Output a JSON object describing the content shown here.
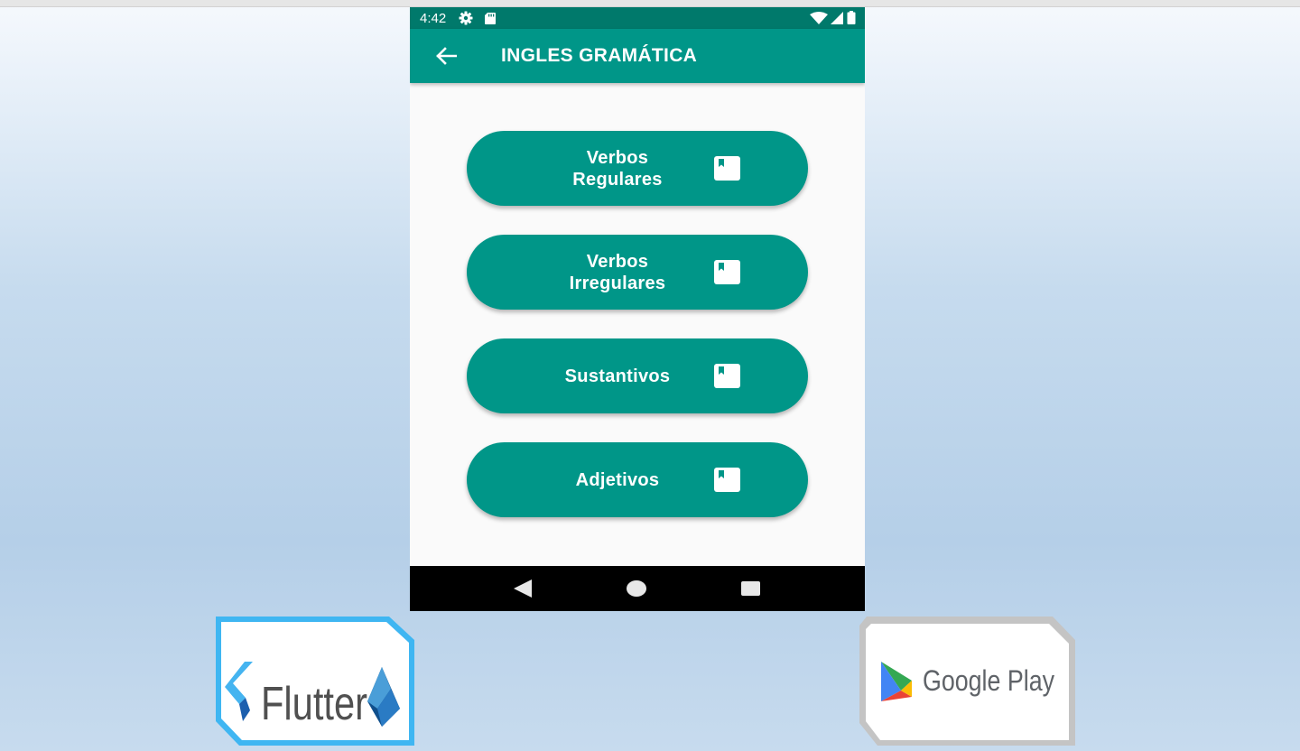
{
  "status_bar": {
    "time": "4:42"
  },
  "app_bar": {
    "title": "INGLES GRAMÁTICA"
  },
  "menu": {
    "items": [
      {
        "line1": "Verbos",
        "line2": "Regulares"
      },
      {
        "line1": "Verbos",
        "line2": "Irregulares"
      },
      {
        "line1": "Sustantivos",
        "line2": ""
      },
      {
        "line1": "Adjetivos",
        "line2": ""
      }
    ]
  },
  "logos": {
    "flutter": "Flutter",
    "google_play": "Google Play"
  },
  "colors": {
    "primary": "#009688",
    "primary_dark": "#00796b",
    "background": "#fafafa",
    "nav_bar": "#000000"
  }
}
